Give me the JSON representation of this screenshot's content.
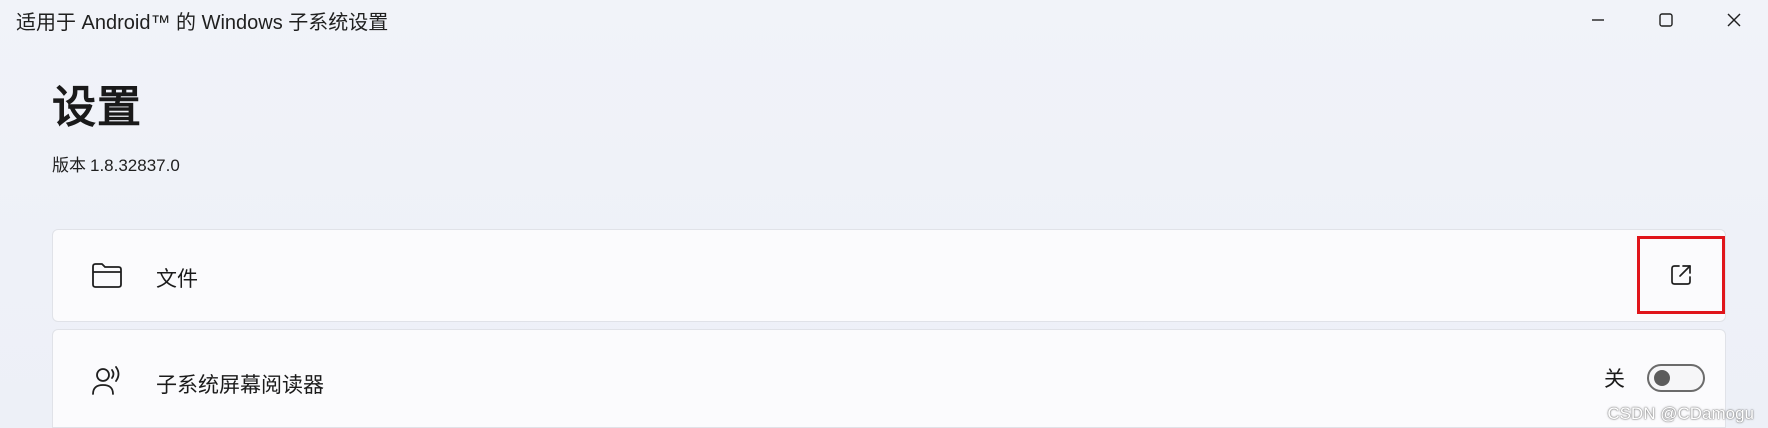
{
  "window": {
    "title": "适用于 Android™ 的 Windows 子系统设置",
    "controls": [
      "minimize",
      "maximize",
      "close"
    ]
  },
  "page": {
    "title": "设置",
    "version_label": "版本",
    "version_value": "1.8.32837.0"
  },
  "settings": {
    "files": {
      "label": "文件",
      "icon": "folder-icon",
      "action_icon": "open-external-icon",
      "highlight_color": "#e0151b"
    },
    "screen_reader": {
      "label": "子系统屏幕阅读器",
      "icon": "screen-reader-icon",
      "toggle_state_label": "关",
      "toggle_on": false
    }
  },
  "watermark": "CSDN @CDamogu"
}
